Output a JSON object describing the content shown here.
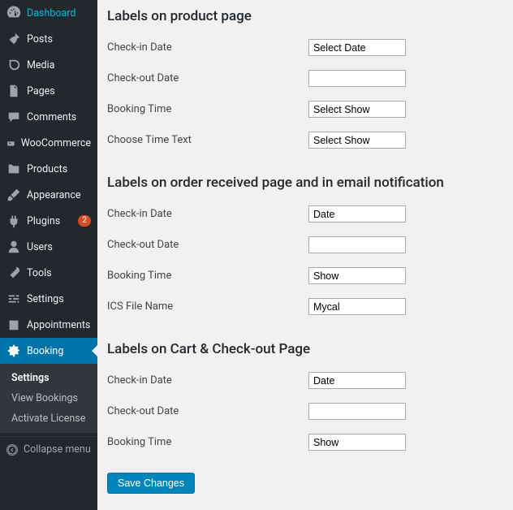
{
  "sidebar": {
    "items": [
      {
        "label": "Dashboard"
      },
      {
        "label": "Posts"
      },
      {
        "label": "Media"
      },
      {
        "label": "Pages"
      },
      {
        "label": "Comments"
      },
      {
        "label": "WooCommerce"
      },
      {
        "label": "Products"
      },
      {
        "label": "Appearance"
      },
      {
        "label": "Plugins",
        "badge": "2"
      },
      {
        "label": "Users"
      },
      {
        "label": "Tools"
      },
      {
        "label": "Settings"
      },
      {
        "label": "Appointments"
      },
      {
        "label": "Booking"
      }
    ],
    "submenu": [
      {
        "label": "Settings"
      },
      {
        "label": "View Bookings"
      },
      {
        "label": "Activate License"
      }
    ],
    "collapse_label": "Collapse menu"
  },
  "sections": {
    "product": {
      "heading": "Labels on product page",
      "checkin_label": "Check-in Date",
      "checkin_value": "Select Date",
      "checkout_label": "Check-out Date",
      "checkout_value": "",
      "bookingtime_label": "Booking Time",
      "bookingtime_value": "Select Show",
      "choosetime_label": "Choose Time Text",
      "choosetime_value": "Select Show"
    },
    "order": {
      "heading": "Labels on order received page and in email notification",
      "checkin_label": "Check-in Date",
      "checkin_value": "Date",
      "checkout_label": "Check-out Date",
      "checkout_value": "",
      "bookingtime_label": "Booking Time",
      "bookingtime_value": "Show",
      "ics_label": "ICS File Name",
      "ics_value": "Mycal"
    },
    "cart": {
      "heading": "Labels on Cart & Check-out Page",
      "checkin_label": "Check-in Date",
      "checkin_value": "Date",
      "checkout_label": "Check-out Date",
      "checkout_value": "",
      "bookingtime_label": "Booking Time",
      "bookingtime_value": "Show"
    }
  },
  "save_label": "Save Changes"
}
